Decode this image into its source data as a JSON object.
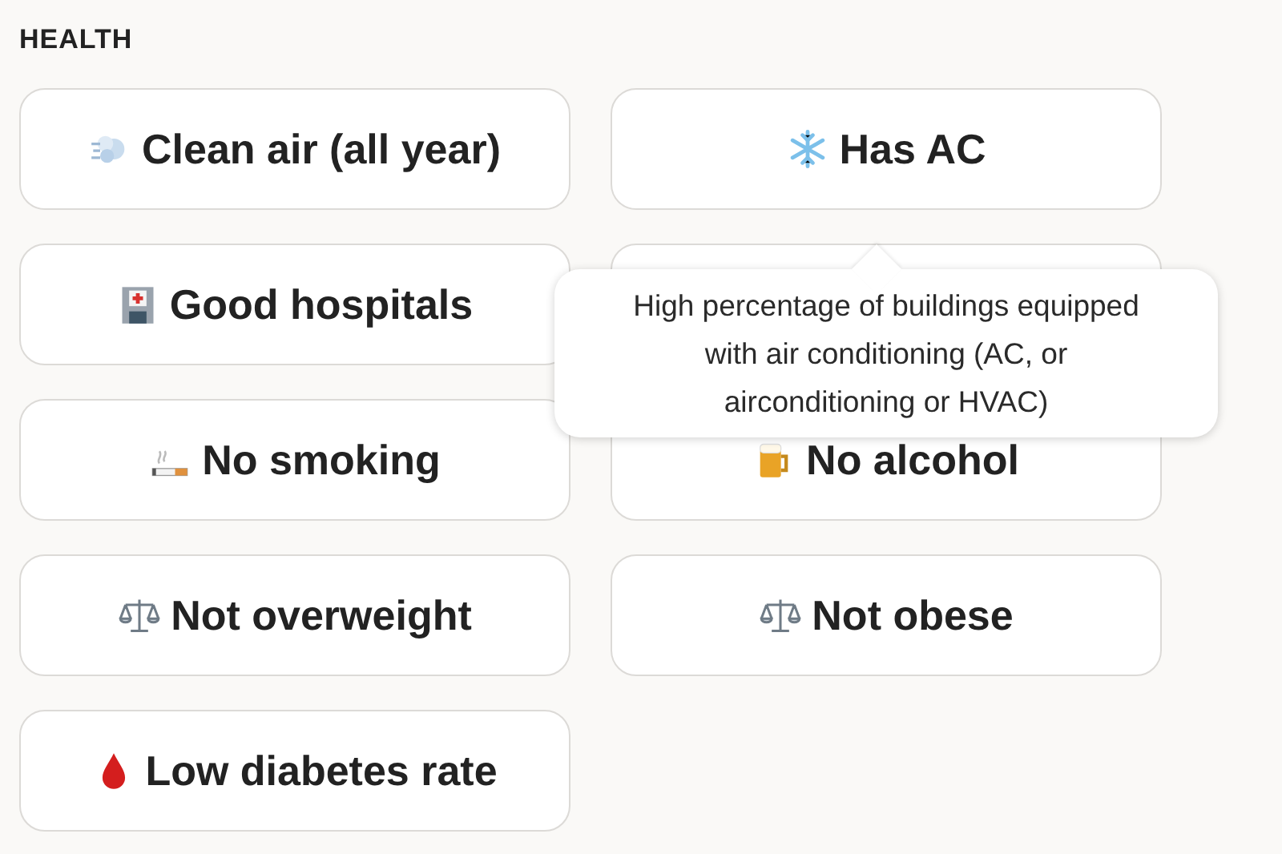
{
  "section_title": "HEALTH",
  "options": [
    {
      "kind": "wind",
      "label": "Clean air (all year)"
    },
    {
      "kind": "snowflake",
      "label": "Has AC"
    },
    {
      "kind": "hospital",
      "label": "Good hospitals"
    },
    {
      "kind": "covered"
    },
    {
      "kind": "cigarette",
      "label": "No smoking"
    },
    {
      "kind": "beer",
      "label": "No alcohol"
    },
    {
      "kind": "scale",
      "label": "Not overweight"
    },
    {
      "kind": "scale",
      "label": "Not obese"
    },
    {
      "kind": "drop",
      "label": "Low diabetes rate"
    }
  ],
  "tooltip": {
    "text": "High percentage of buildings equipped with air conditioning (AC, or airconditioning or HVAC)"
  }
}
